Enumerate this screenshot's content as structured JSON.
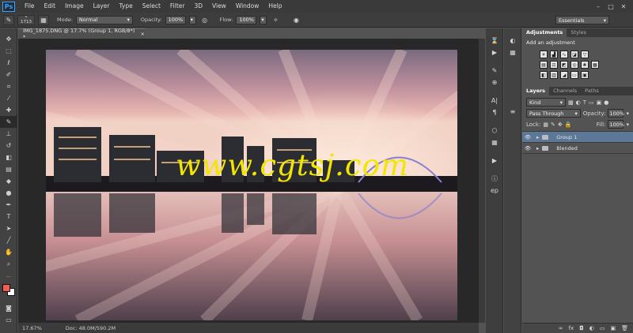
{
  "app": {
    "logo": "Ps"
  },
  "menu": [
    "File",
    "Edit",
    "Image",
    "Layer",
    "Type",
    "Select",
    "Filter",
    "3D",
    "View",
    "Window",
    "Help"
  ],
  "window_controls": {
    "minimize": "–",
    "maximize": "□",
    "close": "✕"
  },
  "options": {
    "brush_size": "1713",
    "mode_label": "Mode:",
    "mode_value": "Normal",
    "opacity_label": "Opacity:",
    "opacity_value": "100%",
    "flow_label": "Flow:",
    "flow_value": "100%",
    "workspace": "Essentials"
  },
  "document": {
    "tab_title": "IMG_1875.DNG @ 17.7% (Group 1, RGB/8*) *",
    "close": "×",
    "watermark": "www.cgtsj.com",
    "zoom": "17.67%",
    "doc_size": "Doc: 48.0M/590.2M"
  },
  "adjustments": {
    "tabs": [
      "Adjustments",
      "Styles"
    ],
    "add_label": "Add an adjustment"
  },
  "layers": {
    "tabs": [
      "Layers",
      "Channels",
      "Paths"
    ],
    "kind_value": "Kind",
    "blend_value": "Pass Through",
    "opacity_label": "Opacity:",
    "opacity_value": "100%",
    "lock_label": "Lock:",
    "fill_label": "Fill:",
    "fill_value": "100%",
    "items": [
      {
        "name": "Group 1"
      },
      {
        "name": "Blended"
      }
    ],
    "footer_icons": [
      "∞",
      "fx",
      "◘",
      "◐",
      "▭",
      "▣",
      "🗑"
    ]
  },
  "colors": {
    "foreground": "#f25d4f",
    "background": "#ffffff",
    "selected_layer": "#5d7796",
    "watermark": "#f2e600"
  }
}
